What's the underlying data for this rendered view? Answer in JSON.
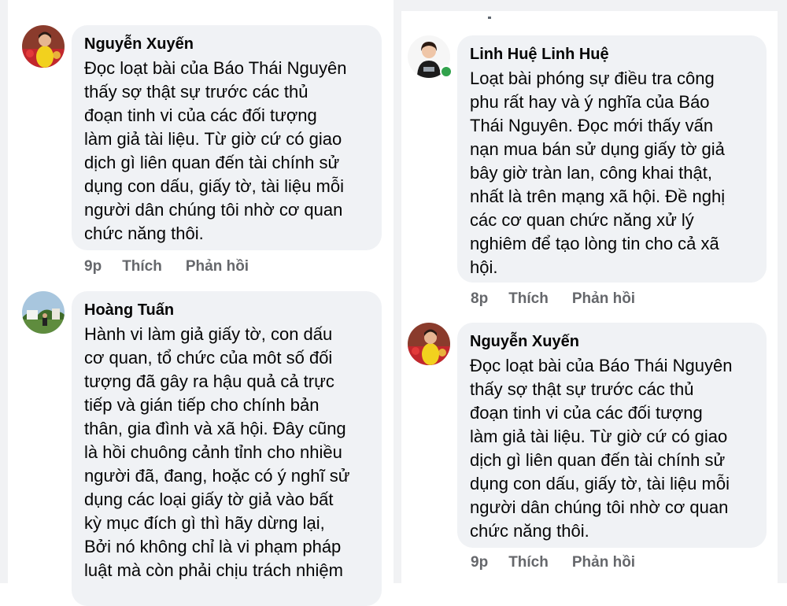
{
  "comments": [
    {
      "author": "Nguyễn Xuyến",
      "lines": [
        "Đọc loạt bài của Báo Thái Nguyên",
        "thấy sợ thật sự trước các thủ",
        "đoạn tinh vi của các đối tượng",
        "làm giả tài liệu. Từ giờ cứ có giao",
        "dịch gì liên quan đến tài chính sử",
        "dụng con dấu, giấy tờ, tài liệu mỗi",
        "người dân chúng tôi nhờ cơ quan",
        "chức năng thôi."
      ],
      "time": "9p",
      "like": "Thích",
      "reply": "Phản hồi"
    },
    {
      "author": "Hoàng Tuấn",
      "lines": [
        "Hành vi làm giả giấy tờ, con dấu",
        "cơ quan, tổ chức của môt số đối",
        "tượng đã gây ra hậu quả cả trực",
        "tiếp và gián tiếp cho chính bản",
        "thân, gia đình và xã hội. Đây cũng",
        "là hồi chuông cảnh tỉnh cho nhiều",
        "người đã, đang, hoặc có ý nghĩ sử",
        "dụng các loại giấy tờ giả vào bất",
        "kỳ mục đích gì thì hãy dừng lại,",
        "Bởi nó không chỉ là vi phạm pháp",
        "luật mà còn phải chịu trách nhiệm"
      ]
    },
    {
      "author": "Linh Huệ Linh Huệ",
      "lines": [
        "Loạt bài phóng sự điều tra công",
        "phu rất hay và ý nghĩa của Báo",
        "Thái Nguyên. Đọc mới thấy vấn",
        "nạn mua bán sử dụng giấy tờ giả",
        "bây giờ tràn lan, công khai thật,",
        "nhất là trên mạng xã hội. Đề nghị",
        "các cơ quan chức năng xử lý",
        "nghiêm để tạo lòng tin cho cả xã",
        "hội."
      ],
      "time": "8p",
      "like": "Thích",
      "reply": "Phản hồi"
    },
    {
      "author": "Nguyễn Xuyến",
      "lines": [
        "Đọc loạt bài của Báo Thái Nguyên",
        "thấy sợ thật sự trước các thủ",
        "đoạn tinh vi của các đối tượng",
        "làm giả tài liệu. Từ giờ cứ có giao",
        "dịch gì liên quan đến tài chính sử",
        "dụng con dấu, giấy tờ, tài liệu mỗi",
        "người dân chúng tôi nhờ cơ quan",
        "chức năng thôi."
      ],
      "time": "9p",
      "like": "Thích",
      "reply": "Phản hồi"
    }
  ],
  "colors": {
    "bubble": "#f0f2f5",
    "page_gap": "#f1f2f4",
    "meta_text": "#65676b",
    "online": "#31a24c"
  },
  "icons": {
    "avatar_1": "avatar-photo-yellow-shirt",
    "avatar_2": "avatar-photo-landscape",
    "avatar_3": "avatar-photo-woman",
    "online_indicator": "online-status-dot"
  }
}
